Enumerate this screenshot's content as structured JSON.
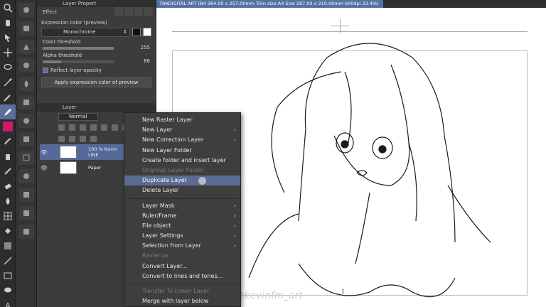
{
  "properties": {
    "tab_title": "Layer Propert",
    "effect_label": "Effect",
    "expression_label": "Expression color (preview)",
    "expression_value": "Monochrome",
    "color_threshold": {
      "label": "Color threshold",
      "value": "255",
      "fraction": 1.0
    },
    "alpha_threshold": {
      "label": "Alpha threshold",
      "value": "66",
      "fraction": 0.26
    },
    "reflect_opacity_label": "Reflect layer opacity",
    "reflect_opacity_checked": true,
    "apply_button": "Apply expression color of preview"
  },
  "layers": {
    "header": "Layer",
    "blend_mode": "Normal",
    "items": [
      {
        "text1": "100 %  Norm",
        "text2": "LINE",
        "selected": true
      },
      {
        "text1": "Paper",
        "text2": "",
        "selected": false
      }
    ]
  },
  "canvas": {
    "tab_title": "TRADIGITAL ART (B4 364.00 x 257.00mm Trim size:A4 Size 297.00 x 210.00mm 600dpi 23.4%)",
    "page_number": "1",
    "watermark": "@kevinfm_art"
  },
  "context_menu": {
    "items": [
      {
        "label": "New Raster Layer",
        "submenu": false,
        "disabled": false
      },
      {
        "label": "New Layer",
        "submenu": true,
        "disabled": false
      },
      {
        "label": "New Correction Layer",
        "submenu": true,
        "disabled": false
      },
      {
        "label": "New Layer Folder",
        "submenu": false,
        "disabled": false
      },
      {
        "label": "Create folder and insert layer",
        "submenu": false,
        "disabled": false
      },
      {
        "label": "Ungroup Layer Folder",
        "submenu": false,
        "disabled": true
      },
      {
        "label": "Duplicate Layer",
        "submenu": false,
        "disabled": false,
        "highlighted": true
      },
      {
        "label": "Delete Layer",
        "submenu": false,
        "disabled": false
      },
      {
        "label": "Layer Mask",
        "submenu": true,
        "disabled": false
      },
      {
        "label": "Ruler/Frame",
        "submenu": true,
        "disabled": false
      },
      {
        "label": "File object",
        "submenu": true,
        "disabled": false
      },
      {
        "label": "Layer Settings",
        "submenu": true,
        "disabled": false
      },
      {
        "label": "Selection from Layer",
        "submenu": true,
        "disabled": false
      },
      {
        "label": "Rasterize",
        "submenu": false,
        "disabled": true
      },
      {
        "label": "Convert Layer...",
        "submenu": false,
        "disabled": false
      },
      {
        "label": "Convert to lines and tones...",
        "submenu": false,
        "disabled": false
      },
      {
        "label": "Transfer To Lower Layer",
        "submenu": false,
        "disabled": true
      },
      {
        "label": "Merge with layer below",
        "submenu": false,
        "disabled": false
      }
    ]
  },
  "colors": {
    "accent": "#5a6c93",
    "main_color": "#d0186c",
    "sub_color": "#ffffff"
  }
}
